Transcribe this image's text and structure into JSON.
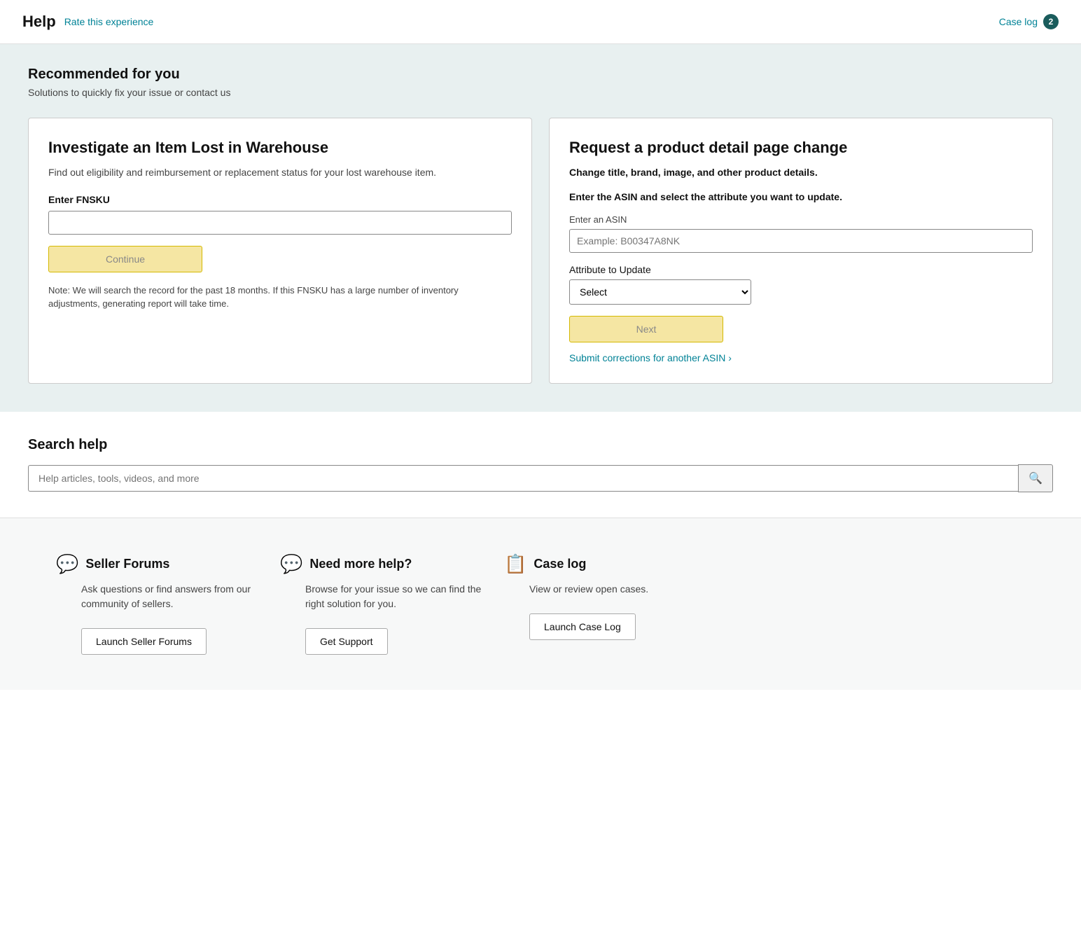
{
  "header": {
    "help_label": "Help",
    "rate_label": "Rate this experience",
    "case_log_label": "Case log",
    "case_log_count": "2"
  },
  "recommended": {
    "title": "Recommended for you",
    "subtitle": "Solutions to quickly fix your issue or contact us",
    "card_left": {
      "title": "Investigate an Item Lost in Warehouse",
      "description": "Find out eligibility and reimbursement or replacement status for your lost warehouse item.",
      "fnsku_label": "Enter FNSKU",
      "fnsku_placeholder": "",
      "continue_label": "Continue",
      "note": "Note: We will search the record for the past 18 months. If this FNSKU has a large number of inventory adjustments, generating report will take time."
    },
    "card_right": {
      "title": "Request a product detail page change",
      "bold_text": "Change title, brand, image, and other product details.",
      "instruction": "Enter the ASIN and select the attribute you want to update.",
      "asin_label": "Enter an ASIN",
      "asin_placeholder": "Example: B00347A8NK",
      "attr_label": "Attribute to Update",
      "attr_default": "Select",
      "next_label": "Next",
      "corrections_link": "Submit corrections for another ASIN ›"
    }
  },
  "search": {
    "title": "Search help",
    "placeholder": "Help articles, tools, videos, and more",
    "search_icon": "🔍"
  },
  "bottom": {
    "seller_forums": {
      "icon": "💬",
      "title": "Seller Forums",
      "description": "Ask questions or find answers from our community of sellers.",
      "button_label": "Launch Seller Forums"
    },
    "need_help": {
      "icon": "💭",
      "title": "Need more help?",
      "description": "Browse for your issue so we can find the right solution for you.",
      "button_label": "Get Support"
    },
    "case_log": {
      "icon": "📋",
      "title": "Case log",
      "description": "View or review open cases.",
      "button_label": "Launch Case Log"
    }
  }
}
